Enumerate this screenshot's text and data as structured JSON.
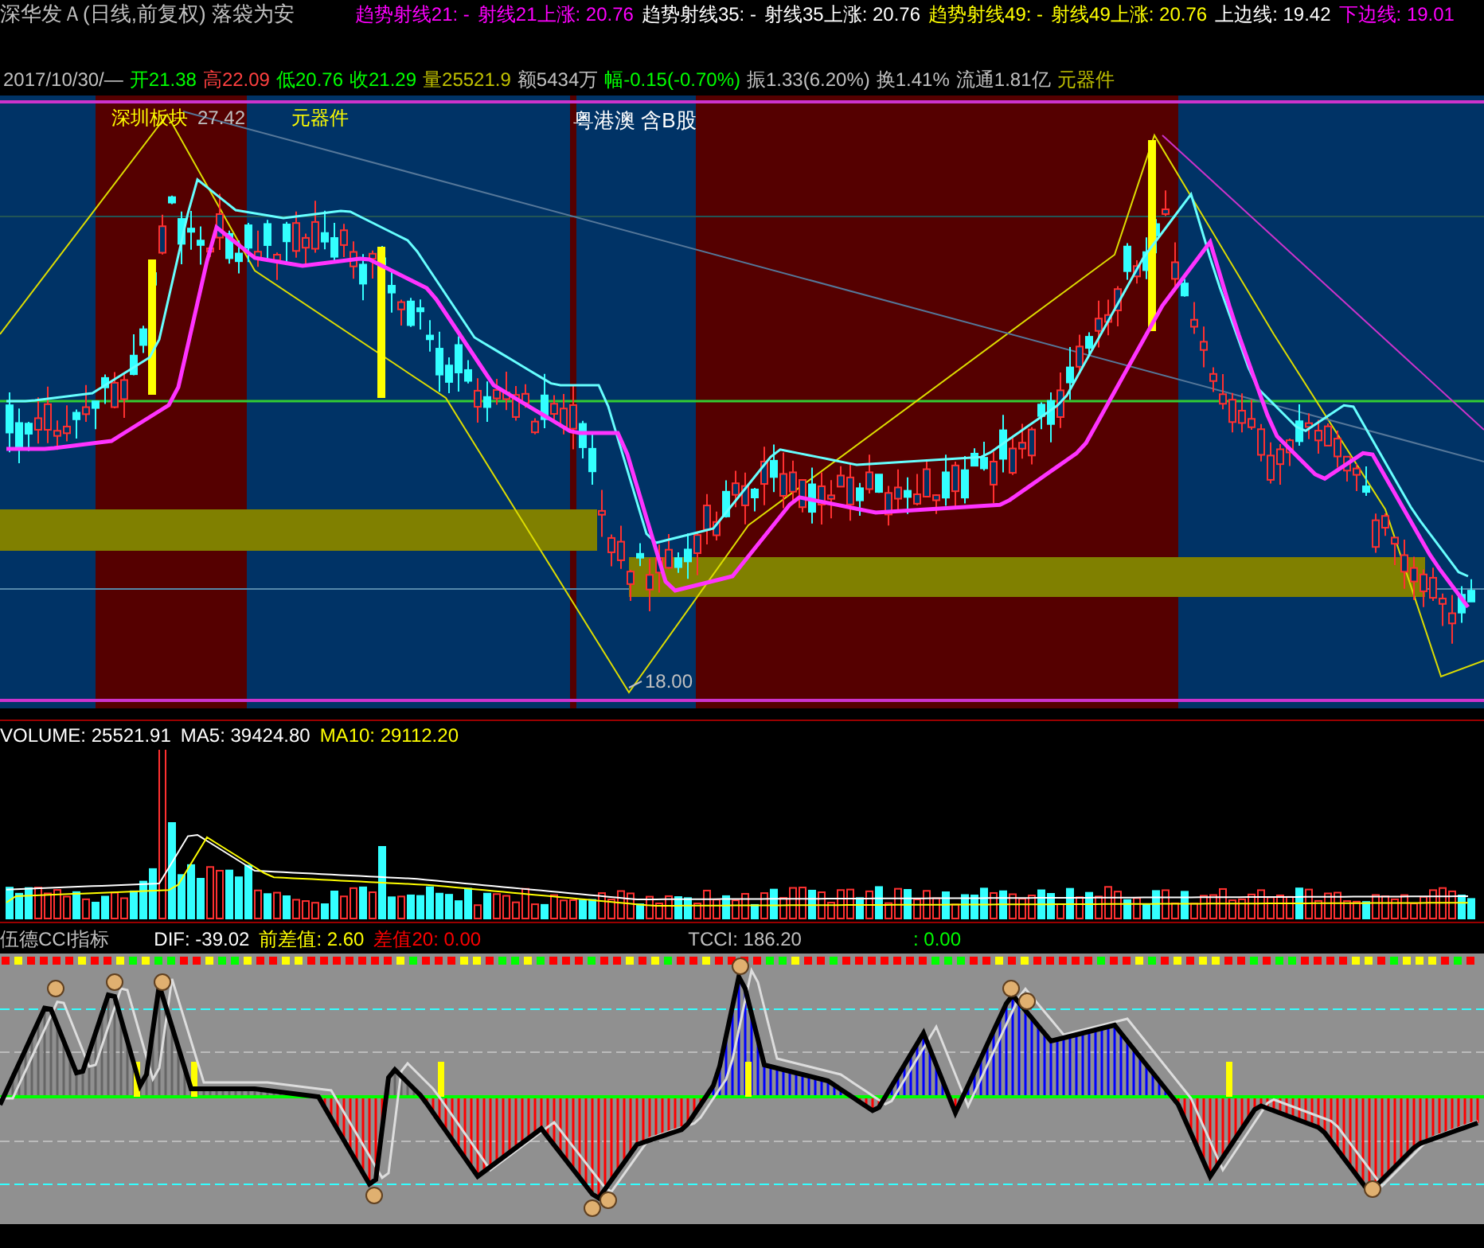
{
  "title": "深华发Ａ(日线,前复权) 落袋为安",
  "indicators": [
    {
      "text": "趋势射线21: -",
      "color": "#ff00ff"
    },
    {
      "text": "射线21上涨: 20.76",
      "color": "#ff00ff"
    },
    {
      "text": "趋势射线35: -",
      "color": "#ffffff"
    },
    {
      "text": "射线35上涨: 20.76",
      "color": "#ffffff"
    },
    {
      "text": "趋势射线49: -",
      "color": "#ffff00"
    },
    {
      "text": "射线49上涨: 20.76",
      "color": "#ffff00"
    },
    {
      "text": "上边线: 19.42",
      "color": "#ffffff"
    },
    {
      "text": "下边线: 19.01",
      "color": "#ff00ff"
    }
  ],
  "quote": [
    {
      "text": "2017/10/30/—",
      "color": "#c0c0c0"
    },
    {
      "text": "开21.38",
      "color": "#00ff00"
    },
    {
      "text": "高22.09",
      "color": "#ff4040"
    },
    {
      "text": "低20.76",
      "color": "#00ff00"
    },
    {
      "text": "收21.29",
      "color": "#00ff00"
    },
    {
      "text": "量25521.9",
      "color": "#c0c000"
    },
    {
      "text": "额5434万",
      "color": "#c0c0c0"
    },
    {
      "text": "幅-0.15(-0.70%)",
      "color": "#00ff00"
    },
    {
      "text": "振1.33(6.20%)",
      "color": "#c0c0c0"
    },
    {
      "text": "换1.41%",
      "color": "#c0c0c0"
    },
    {
      "text": "流通1.81亿",
      "color": "#c0c0c0"
    },
    {
      "text": "元器件",
      "color": "#c0c000"
    }
  ],
  "chart_labels": [
    {
      "text": "深圳板块",
      "color": "#ffff00"
    },
    {
      "text": "27.42",
      "color": "#c0c0c0"
    },
    {
      "text": "元器件",
      "color": "#ffff00"
    },
    {
      "text": "粤港澳 含B股",
      "color": "#ffffff"
    },
    {
      "text": "18.00",
      "color": "#c0c0c0"
    }
  ],
  "volume_legend": [
    {
      "text": "VOLUME: 25521.91",
      "color": "#ffffff"
    },
    {
      "text": "MA5: 39424.80",
      "color": "#ffffff"
    },
    {
      "text": "MA10: 29112.20",
      "color": "#ffff00"
    }
  ],
  "cci_legend": [
    {
      "text": "伍德CCI指标",
      "color": "#c0c0c0"
    },
    {
      "text": "DIF: -39.02",
      "color": "#ffffff"
    },
    {
      "text": "前差值: 2.60",
      "color": "#ffff00"
    },
    {
      "text": "差值20: 0.00",
      "color": "#ff0000"
    },
    {
      "text": "TCCI: 186.20",
      "color": "#c0c0c0"
    },
    {
      "text": ": 0.00",
      "color": "#00ff00"
    }
  ]
}
